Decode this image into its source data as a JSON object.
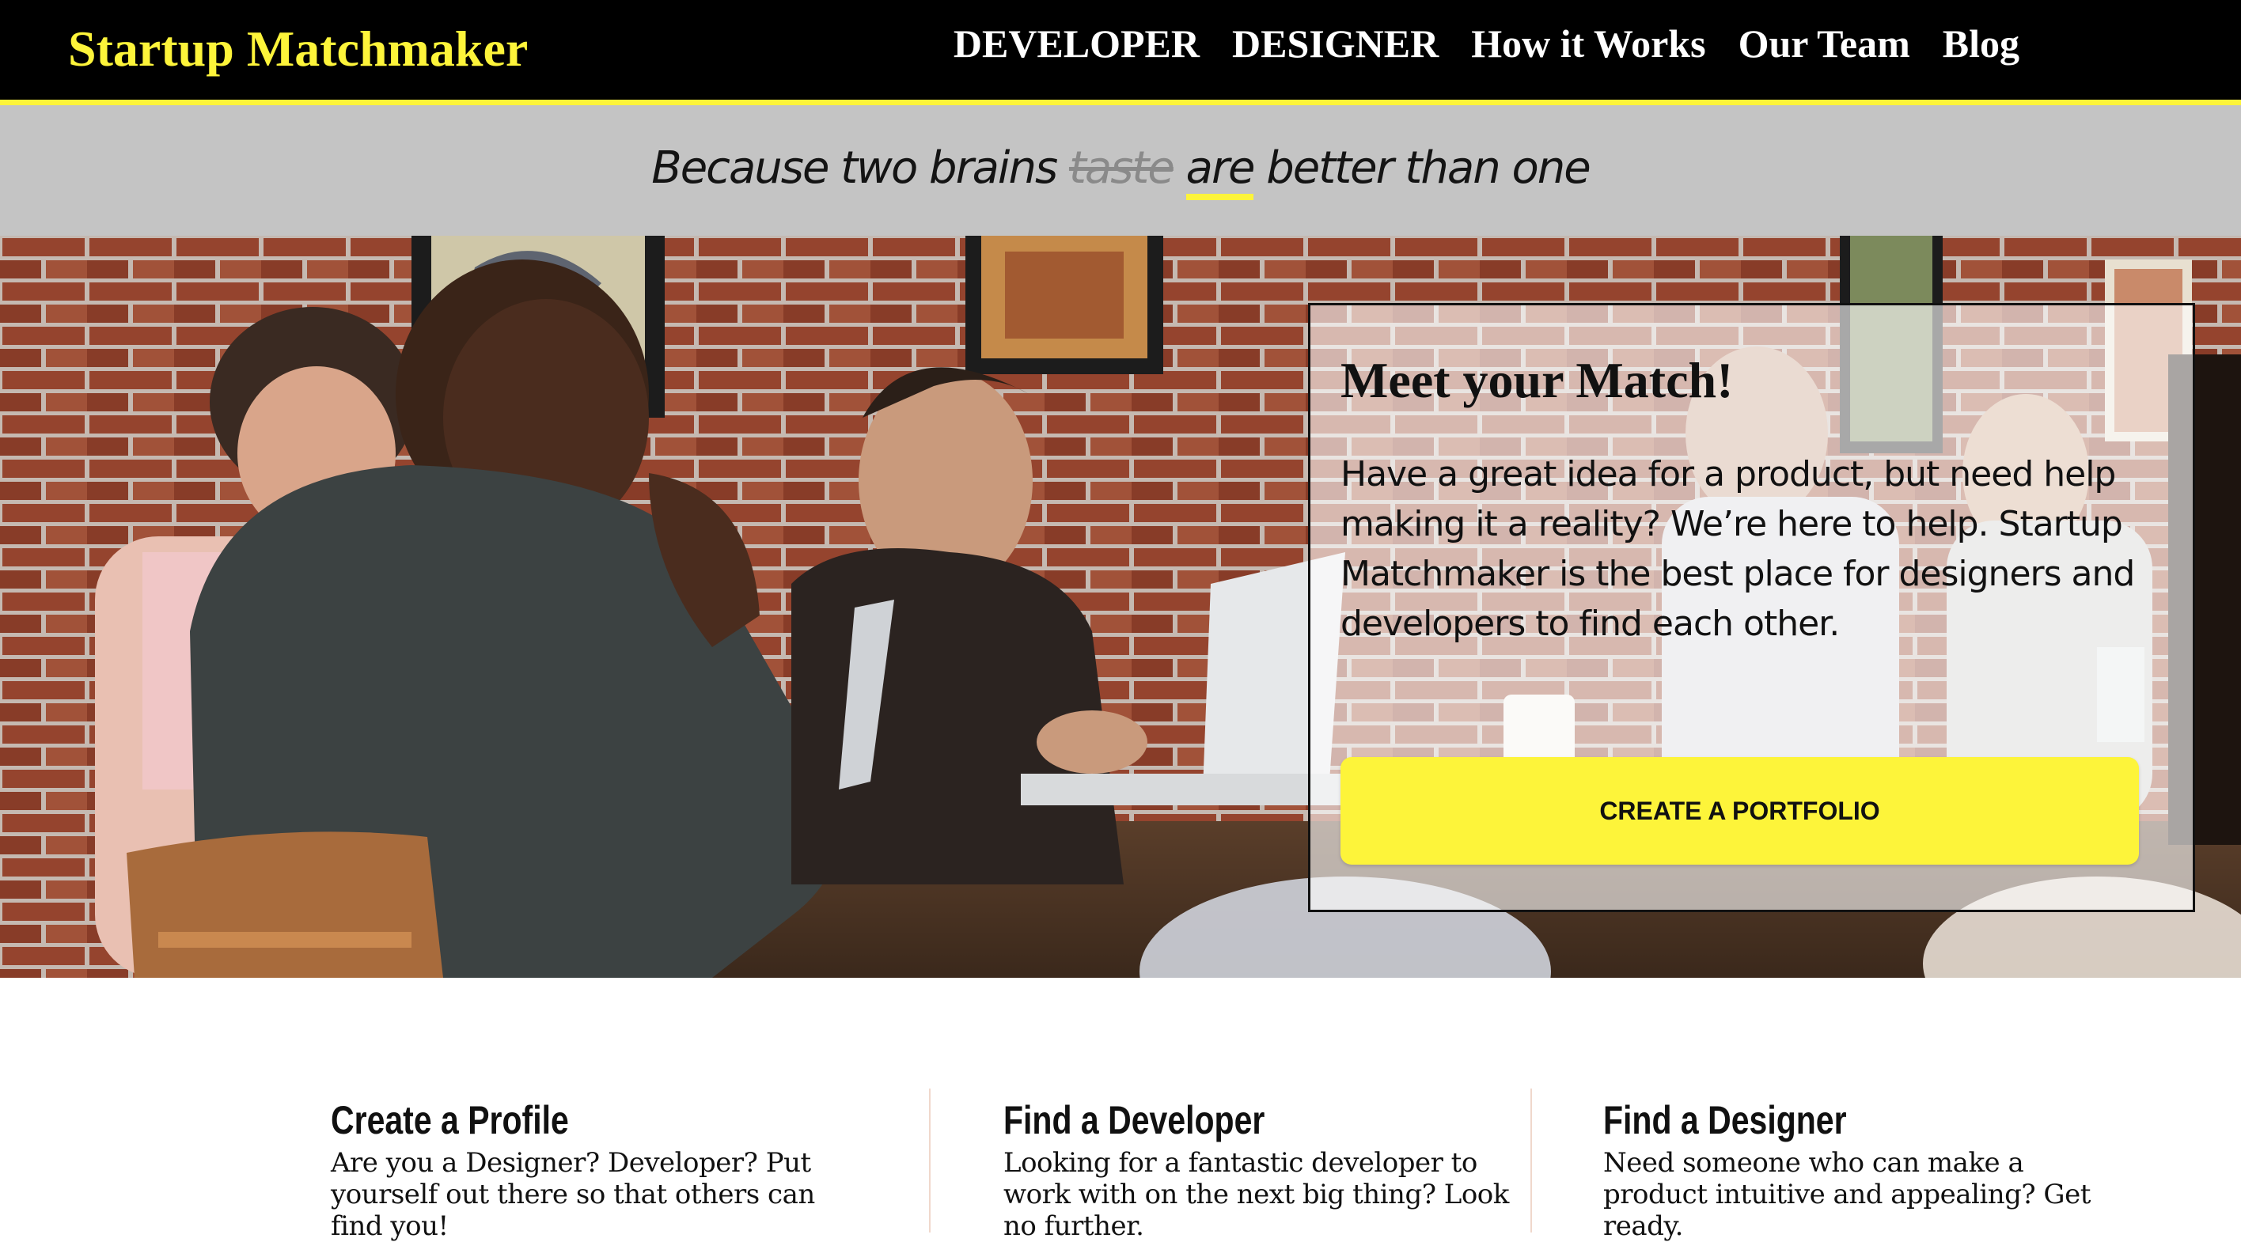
{
  "navbar": {
    "brand": "Startup Matchmaker",
    "links": [
      {
        "label": "DEVELOPER"
      },
      {
        "label": "DESIGNER"
      },
      {
        "label": "How it Works"
      },
      {
        "label": "Our Team"
      },
      {
        "label": "Blog"
      }
    ]
  },
  "tagline": {
    "prefix": "Because two brains",
    "struck_word": "taste",
    "highlight_word": "are",
    "suffix": "better than one"
  },
  "hero": {
    "card_title": "Meet your Match!",
    "card_body": "Have a great idea for a product, but need help making it a reality? We’re here to help. Startup Matchmaker is the best place for designers and developers to find each other.",
    "cta_label": "CREATE A PORTFOLIO"
  },
  "features": [
    {
      "title": "Create a Profile",
      "text": "Are you a Designer? Developer? Put yourself out there so that others can find you!"
    },
    {
      "title": "Find a Developer",
      "text": "Looking for a fantastic developer to work with on the next big thing? Look no further."
    },
    {
      "title": "Find a Designer",
      "text": "Need someone who can make a product intuitive and appealing? Get ready."
    }
  ],
  "colors": {
    "accent": "#fdf43a",
    "nav_bg": "#000000",
    "tagline_bg": "#c4c4c4"
  }
}
